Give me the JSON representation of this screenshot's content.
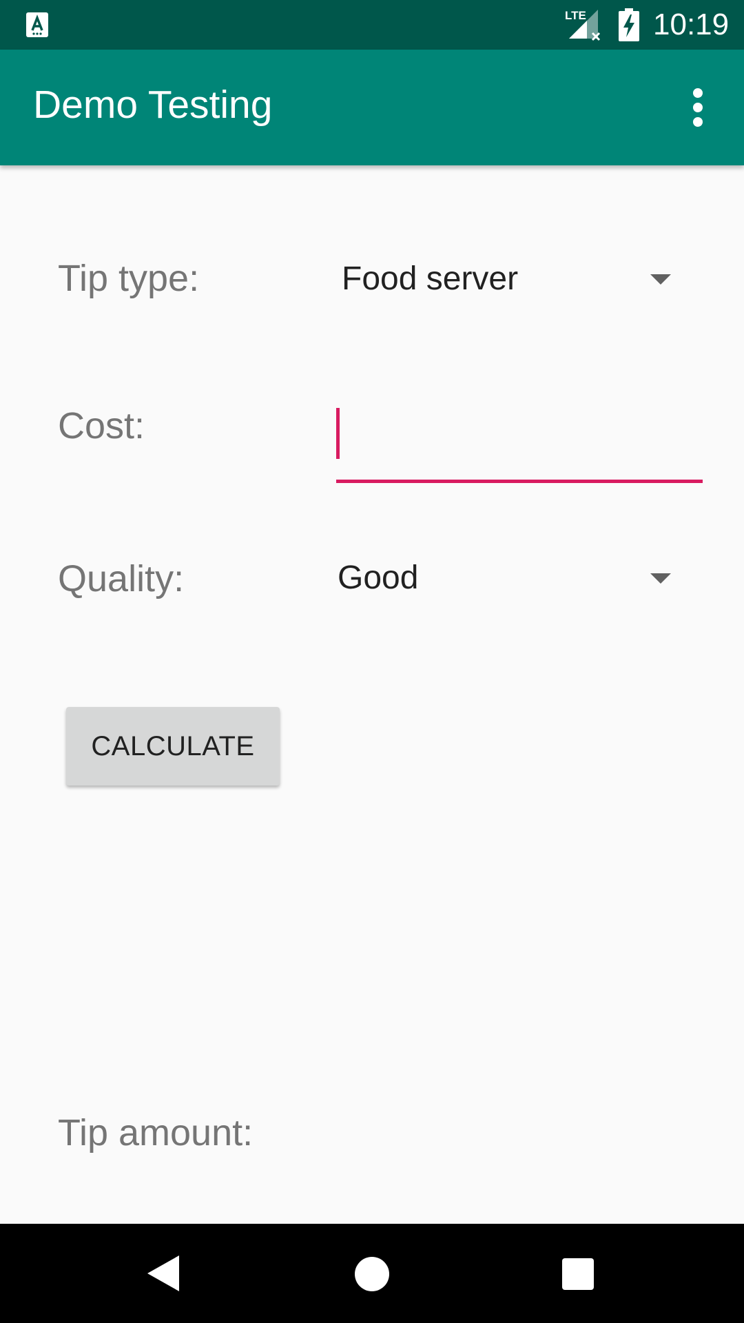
{
  "status_bar": {
    "time": "10:19",
    "network": "LTE",
    "icons": [
      "app-notification-icon",
      "lte-signal-icon",
      "battery-charging-icon"
    ]
  },
  "app_bar": {
    "title": "Demo Testing",
    "menu_icon": "overflow-menu-icon"
  },
  "form": {
    "tip_type_label": "Tip type:",
    "tip_type_value": "Food server",
    "cost_label": "Cost:",
    "cost_value": "",
    "quality_label": "Quality:",
    "quality_value": "Good",
    "calculate_label": "CALCULATE",
    "tip_amount_label": "Tip amount:"
  },
  "nav_bar": {
    "icons": [
      "back-icon",
      "home-icon",
      "recents-icon"
    ]
  },
  "colors": {
    "status_bar": "#00574b",
    "app_bar": "#008577",
    "accent": "#d81b60",
    "background": "#fafafa",
    "button": "#d6d7d7"
  }
}
